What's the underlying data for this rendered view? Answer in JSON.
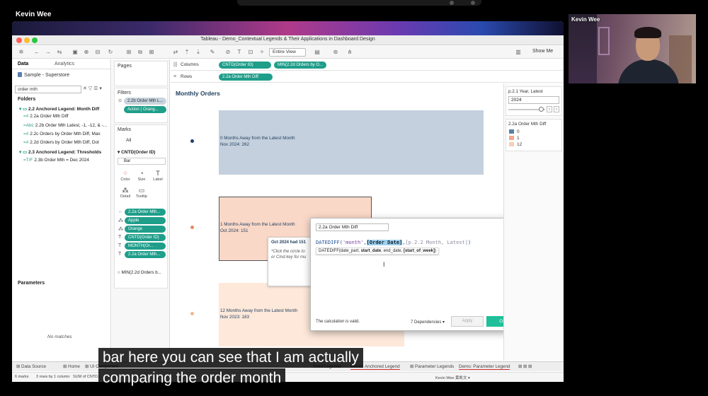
{
  "meeting": {
    "host_name": "Kevin Wee",
    "webcam_label": "Kevin Wee"
  },
  "window": {
    "title": "Tableau - Demo_Contextual Legends & Their Applications in Dashboard Design"
  },
  "toolbar": {
    "view_select": "Entire View",
    "show_me": "Show Me"
  },
  "data_pane": {
    "tab_data": "Data",
    "tab_analytics": "Analytics",
    "source": "Sample - Superstore",
    "search_value": "order mth",
    "search_tools": "✕  ▽  ☰ ▾",
    "folders_heading": "Folders",
    "tree": [
      {
        "label": "2.2 Anchored Legend: Month Diff",
        "type": "folder",
        "glyph": "▾ ▭"
      },
      {
        "label": "2.2a Order Mth Diff",
        "type": "selected",
        "glyph": "=#"
      },
      {
        "label": "2.2b Order Mth Latest, -1, -12, & -...",
        "type": "field",
        "glyph": "=Abc"
      },
      {
        "label": "2.2c Orders by Order Mth Diff, Max",
        "type": "field",
        "glyph": "=#"
      },
      {
        "label": "2.2d Orders by Order Mth Diff, Dot",
        "type": "field",
        "glyph": "=#"
      },
      {
        "label": "2.3 Anchored Legend: Thresholds",
        "type": "folder",
        "glyph": "▾ ▭"
      },
      {
        "label": "2.3b Order Mth = Dec 2024",
        "type": "field",
        "glyph": "=T/F"
      }
    ],
    "parameters_heading": "Parameters",
    "no_matches": "No matches"
  },
  "pages_card": {
    "title": "Pages"
  },
  "filters_card": {
    "title": "Filters",
    "filter_pill": "2.2b Order Mth L...",
    "action_pill": "Action ( Orang...",
    "filter_glyph": "⊙"
  },
  "marks_card": {
    "title": "Marks",
    "all_label": "All",
    "measure_label": "CNTD(Order ID)",
    "mark_type": "Bar",
    "buttons": [
      {
        "label": "Color",
        "glyph": "⁘"
      },
      {
        "label": "Size",
        "glyph": "◔"
      },
      {
        "label": "Label",
        "glyph": "T"
      },
      {
        "label": "Detail",
        "glyph": "⁂"
      },
      {
        "label": "Tooltip",
        "glyph": "▭"
      }
    ],
    "pills": [
      {
        "label": "2.2a Order Mth...",
        "icon": "⁘"
      },
      {
        "label": "Apple",
        "icon": "⁂"
      },
      {
        "label": "Orange",
        "icon": "⁂"
      },
      {
        "label": "CNTD(Order ID)",
        "icon": "T"
      },
      {
        "label": "MONTH(Or...",
        "icon": "T"
      },
      {
        "label": "2.2a Order Mth...",
        "icon": "T"
      }
    ],
    "second_measure": "MIN(2.2d Orders b...",
    "second_glyph": "○"
  },
  "shelves": {
    "columns_label": "Columns",
    "columns_pills": [
      "CNTD(Order ID)",
      "MIN(2.2d Orders by O..."
    ],
    "rows_label": "Rows",
    "rows_pills": [
      "2.2a Order Mth Diff"
    ],
    "columns_icon": "|||",
    "rows_icon": "≡"
  },
  "viz": {
    "title": "Monthly Orders",
    "bars": [
      {
        "line1": "0 Months Away from the Latest Month",
        "line2": "Nov 2024: 262",
        "color": "#c4d0dd",
        "dot": "#1f3d6a"
      },
      {
        "line1": "1 Months Away from the Latest Month",
        "line2": "Oct 2024: 151",
        "color": "#fad8c8",
        "dot": "#e98a5e"
      },
      {
        "line1": "12 Months Away from the Latest Month",
        "line2": "Nov 2023: 183",
        "color": "#fde8da",
        "dot": "#f3b78f"
      }
    ],
    "tooltip": {
      "line1": "Oct 2024 had 151",
      "line2": "*Click the circle to",
      "line3": "or Cmd key for mu"
    }
  },
  "calc_dialog": {
    "name": "2.2a Order Mth Diff",
    "formula_func": "DATEDIFF(",
    "formula_str": "'month'",
    "formula_sep1": ",",
    "formula_field": "[Order Date]",
    "formula_sep2": ",",
    "formula_param": "[p.2.2 Month, Latest]",
    "formula_end": ")",
    "hint_prefix": "DATEDIFF(date_part, ",
    "hint_bold1": "start_date",
    "hint_mid": ", end_date, ",
    "hint_bold2": "[start_of_week]",
    "hint_end": ")",
    "valid_text": "The calculation is valid.",
    "dependencies": "7 Dependencies ▾",
    "apply": "Apply",
    "ok": "OK",
    "close": "×",
    "expand": "›"
  },
  "right_pane": {
    "param_title": "p.2.1 Year, Latest",
    "param_value": "2024",
    "legend_title": "2.2a Order Mth Diff",
    "legend": [
      {
        "label": "0",
        "color": "#5a7ea8"
      },
      {
        "label": "1",
        "color": "#f2a889"
      },
      {
        "label": "12",
        "color": "#f8cdb3"
      }
    ]
  },
  "tabs": [
    {
      "label": "⊞ Data Source"
    },
    {
      "label": "⊞ Home"
    },
    {
      "label": "⊞ UI Component"
    },
    {
      "label": "Ored Legends"
    },
    {
      "label": "Demo: Anchored Legend",
      "underline": true
    },
    {
      "label": "⊞ Parameter Legends"
    },
    {
      "label": "Demo: Parameter Legend",
      "underline": true
    },
    {
      "label": "⊞ ⊞ ⊞"
    }
  ],
  "status": {
    "marks": "6 marks",
    "rows": "3 rows by 1 column",
    "sum": "SUM of CNTD...",
    "user": "Kevin Wee 黄凯文 ▾"
  },
  "subtitles": [
    "bar here you can see that I am actually",
    "comparing the order month"
  ]
}
